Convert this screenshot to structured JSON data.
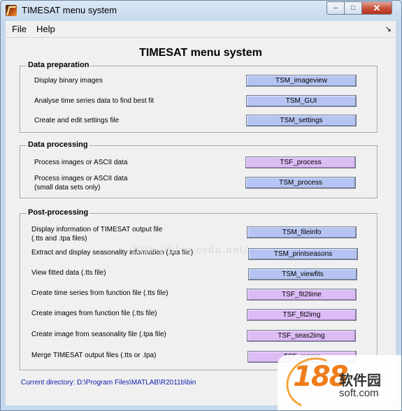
{
  "window": {
    "title": "TIMESAT menu system",
    "minimize": "–",
    "maximize": "□",
    "close": "✕"
  },
  "menubar": {
    "file": "File",
    "help": "Help",
    "arrow": "↘"
  },
  "main_title": "TIMESAT menu system",
  "data_preparation": {
    "title": "Data preparation",
    "rows": [
      {
        "label": "Display binary images",
        "button": "TSM_imageview"
      },
      {
        "label": "Analyse time series data to find best fit",
        "button": "TSM_GUI"
      },
      {
        "label": "Create and edit settings file",
        "button": "TSM_settings"
      }
    ]
  },
  "data_processing": {
    "title": "Data processing",
    "rows": [
      {
        "label": "Process images or ASCII data",
        "label2": "",
        "button": "TSF_process"
      },
      {
        "label": "Process images or ASCII data",
        "label2": "(small data sets only)",
        "button": "TSM_process"
      }
    ]
  },
  "post_processing": {
    "title": "Post-processing",
    "rows": [
      {
        "label": "Display information of TIMESAT output file",
        "label2": "(.tts and .tpa files)",
        "button": "TSM_fileinfo"
      },
      {
        "label": "Extract and display seasonality information (.tpa file)",
        "label2": "",
        "button": "TSM_printseasons"
      },
      {
        "label": "View fitted data (.tts file)",
        "label2": "",
        "button": "TSM_viewfits"
      },
      {
        "label": "Create time series from function file (.tts file)",
        "label2": "",
        "button": "TSF_fit2time"
      },
      {
        "label": "Create images from function file (.tts file)",
        "label2": "",
        "button": "TSF_fit2img"
      },
      {
        "label": "Create image from seasonality file (.tpa file)",
        "label2": "",
        "button": "TSF_seas2img"
      },
      {
        "label": "Merge TIMESAT output files (.tts or .tpa)",
        "label2": "",
        "button": "TSF_merge"
      }
    ]
  },
  "current_directory": "Current directory:   D:\\Program Files\\MATLAB\\R2011b\\bin",
  "watermark": "http://blog.csdn.net/",
  "badge": {
    "number": "188",
    "cn": "软件园",
    "en": "soft.com"
  },
  "colors": {
    "blue_button": "#b5c4f2",
    "violet_button": "#dcbcf5",
    "directory_text": "#0a1aa8"
  }
}
